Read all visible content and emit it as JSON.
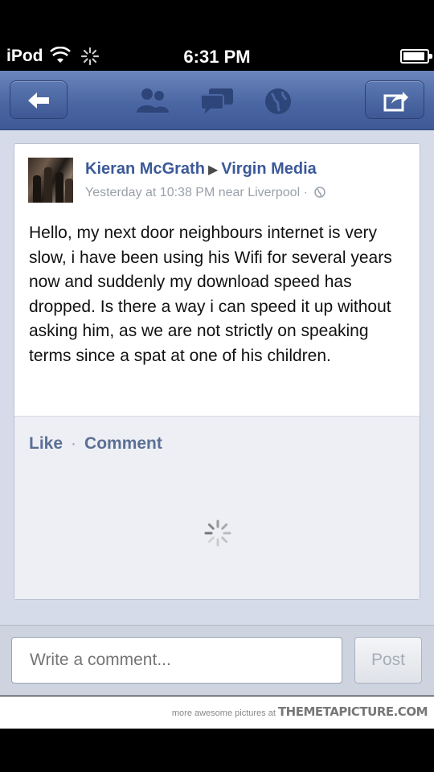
{
  "status_bar": {
    "carrier": "iPod",
    "time": "6:31 PM",
    "icons": [
      "wifi-icon",
      "activity-icon",
      "battery-icon"
    ]
  },
  "nav_bar": {
    "icons": [
      "back-arrow-icon",
      "friends-icon",
      "messages-icon",
      "notifications-globe-icon",
      "share-icon"
    ],
    "accent_color": "#4b67a3"
  },
  "post": {
    "author": "Kieran McGrath",
    "target": "Virgin Media",
    "timestamp": "Yesterday at 10:38 PM near Liverpool",
    "meta_separator": "·",
    "body": "Hello, my next door neighbours internet is very slow, i have been using his Wifi for several years now and suddenly my download speed has dropped. Is there a way i can speed it up without asking him, as we are not strictly on speaking terms since a spat at one of his children.",
    "actions": {
      "like_label": "Like",
      "separator": "·",
      "comment_label": "Comment"
    },
    "link_color": "#3b5998"
  },
  "composer": {
    "placeholder": "Write a comment...",
    "post_label": "Post"
  },
  "watermark": {
    "prefix": "more awesome pictures at",
    "brand": "THEMETAPICTURE.COM"
  }
}
